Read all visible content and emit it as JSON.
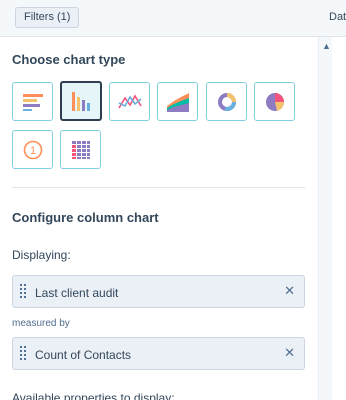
{
  "topbar": {
    "filters_label": "Filters (1)",
    "right_text": "Dat"
  },
  "chart_type": {
    "title": "Choose chart type",
    "options": [
      {
        "icon": "horizontal-bar-chart-icon",
        "selected": false
      },
      {
        "icon": "column-chart-icon",
        "selected": true
      },
      {
        "icon": "line-chart-icon",
        "selected": false
      },
      {
        "icon": "area-chart-icon",
        "selected": false
      },
      {
        "icon": "donut-chart-icon",
        "selected": false
      },
      {
        "icon": "pie-chart-icon",
        "selected": false
      },
      {
        "icon": "single-value-icon",
        "selected": false,
        "text": "1"
      },
      {
        "icon": "pivot-table-icon",
        "selected": false
      }
    ]
  },
  "configure": {
    "title": "Configure column chart",
    "displaying_label": "Displaying:",
    "displaying_value": "Last client audit",
    "measured_by_label": "measured by",
    "measured_value": "Count of Contacts",
    "available_label_partial": "Available properties to display:"
  },
  "colors": {
    "accent_teal": "#7fd1de",
    "selected_border": "#2d3e50",
    "orange": "#ff8f59",
    "purple": "#8e7cc3",
    "blue": "#6ab0de",
    "pink": "#f2547d",
    "green": "#00bda5",
    "yellow": "#f5c26b"
  }
}
